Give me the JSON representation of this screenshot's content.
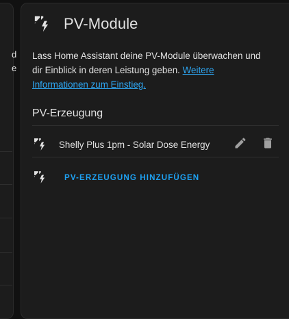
{
  "left_card": {
    "lines": [
      "d",
      "e"
    ]
  },
  "card": {
    "title": "PV-Module",
    "title_icon": "solar-power-icon",
    "description": "Lass Home Assistant deine PV-Module überwachen und dir Einblick in deren Leistung geben.",
    "link_text": "Weitere Informationen zum Einstieg.",
    "section_title": "PV-Erzeugung",
    "sources": [
      {
        "label": "Shelly Plus 1pm - Solar Dose Energy",
        "icon": "solar-power-icon",
        "edit_icon": "pencil-icon",
        "delete_icon": "trash-icon"
      }
    ],
    "add_label": "PV-ERZEUGUNG HINZUFÜGEN",
    "add_icon": "solar-power-icon"
  },
  "colors": {
    "background": "#111111",
    "card": "#1c1c1c",
    "text": "#e1e1e1",
    "accent": "#1ea1f2",
    "icon": "#e1e1e1"
  }
}
